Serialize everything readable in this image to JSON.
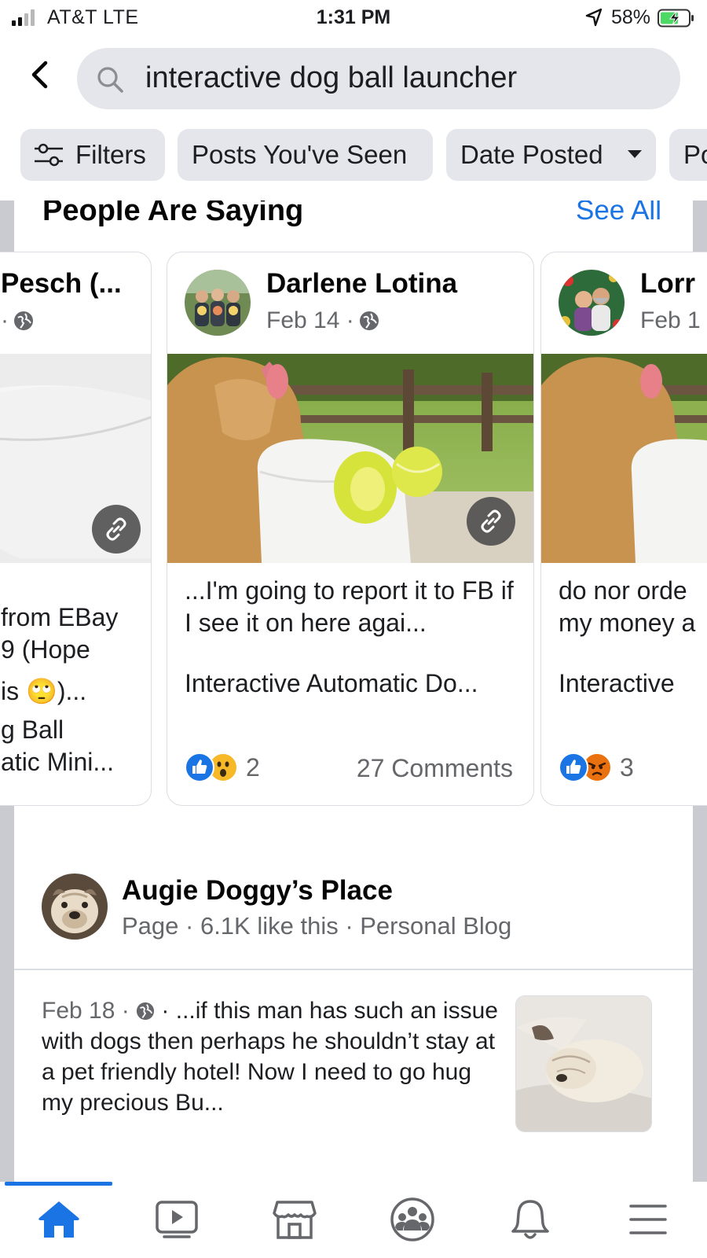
{
  "status_bar": {
    "carrier": "AT&T  LTE",
    "time": "1:31 PM",
    "battery": "58%"
  },
  "search": {
    "query": "interactive dog ball launcher"
  },
  "filters": {
    "filters_label": "Filters",
    "posts_seen_label": "Posts You've Seen",
    "date_posted_label": "Date Posted",
    "more_label": "Po"
  },
  "people_saying": {
    "title": "People Are Saying",
    "see_all": "See All",
    "cards": [
      {
        "name": "Pesch (...",
        "meta": "·",
        "lines": [
          "from EBay",
          "9 (Hope",
          "is 🙄)...",
          "g Ball",
          "atic Mini..."
        ]
      },
      {
        "name": "Darlene Lotina",
        "meta": "Feb 14 ·",
        "snippet": "...I'm going to report it to FB if I see it on here agai...",
        "product": "Interactive Automatic Do...",
        "reaction_count": "2",
        "comments": "27 Comments"
      },
      {
        "name": "Lorr",
        "meta": "Feb 1",
        "snippet": "do nor orde my money a",
        "product": "Interactive",
        "reaction_count": "3"
      }
    ]
  },
  "page_result": {
    "name": "Augie Doggy’s Place",
    "meta": "Page · 6.1K like this · Personal Blog",
    "post_date": "Feb 18 ·",
    "post_text": " · ...if this man has such an issue with dogs then perhaps he shouldn’t stay at a pet friendly hotel! Now I need to go hug my precious Bu..."
  },
  "colors": {
    "accent": "#1b74e4",
    "chip_bg": "#e4e6eb",
    "content_bg": "#cacbd0"
  }
}
